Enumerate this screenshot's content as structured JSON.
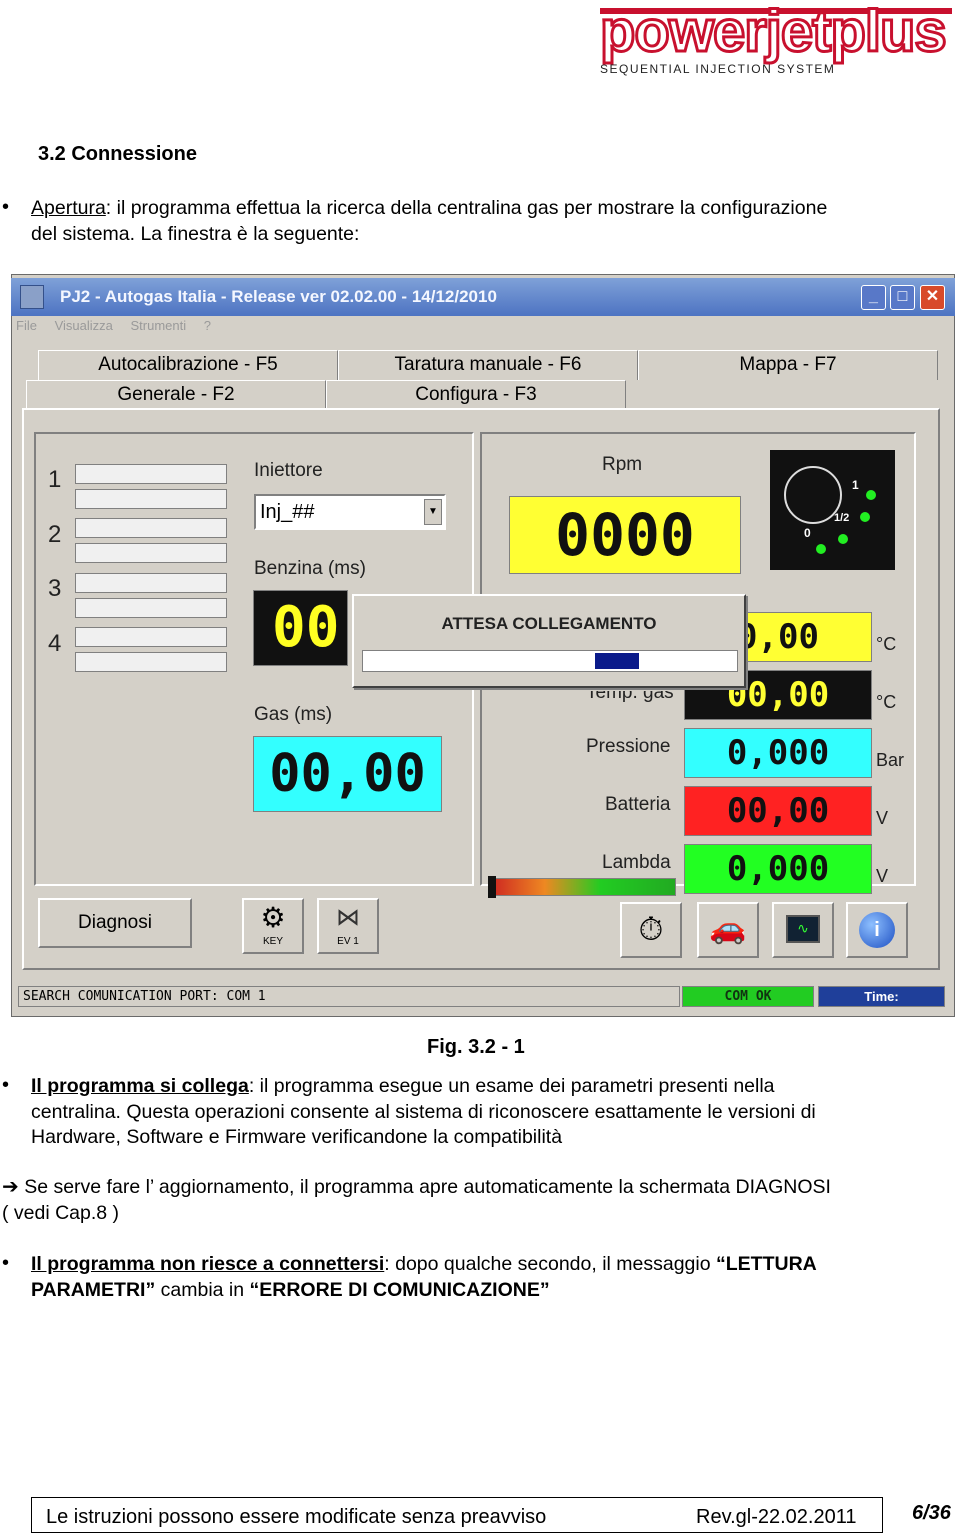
{
  "logo": {
    "name": "powerjetplus",
    "tagline": "SEQUENTIAL INJECTION SYSTEM"
  },
  "section_title": "3.2 Connessione",
  "bullet1": {
    "term": "Apertura",
    "text_line1": ": il programma effettua la ricerca della centralina gas per mostrare la configurazione",
    "text_line2": "del sistema. La finestra è la seguente:"
  },
  "app": {
    "title": "PJ2 - Autogas Italia - Release  ver 02.02.00 - 14/12/2010",
    "menu": [
      "File",
      "Visualizza",
      "Strumenti",
      "?"
    ],
    "tabs_back": [
      "Autocalibrazione - F5",
      "Taratura manuale - F6",
      "Mappa - F7"
    ],
    "tabs_front": [
      "Generale - F2",
      "Configura - F3"
    ],
    "cylinders": [
      "1",
      "2",
      "3",
      "4"
    ],
    "iniettore_label": "Iniettore",
    "iniettore_value": "Inj_##",
    "benzina_label": "Benzina (ms)",
    "benzina_value": "00,",
    "gas_label": "Gas (ms)",
    "gas_value": "00,00",
    "rpm_label": "Rpm",
    "rpm_value": "0000",
    "gauge_labels": {
      "one": "1",
      "half": "1/2",
      "zero": "0"
    },
    "temp1_value": "0,00",
    "temp1_unit": "°C",
    "temp_gas_label": "Temp. gas",
    "temp_gas_value": "00,00",
    "temp_gas_unit": "°C",
    "pressione_label": "Pressione",
    "pressione_value": "0,000",
    "pressione_unit": "Bar",
    "batteria_label": "Batteria",
    "batteria_value": "00,00",
    "batteria_unit": "V",
    "lambda_label": "Lambda",
    "lambda_value": "0,000",
    "lambda_unit": "V",
    "dialog_text": "ATTESA COLLEGAMENTO",
    "diagnosi_button": "Diagnosi",
    "key_label": "KEY",
    "ev_label": "EV 1",
    "status_text": "SEARCH COMUNICATION PORT: COM 1",
    "com_status": "COM OK",
    "time_label": "Time:"
  },
  "figure_caption": "Fig. 3.2 - 1",
  "bullet2": {
    "term": "Il programma si collega",
    "line1": ":   il programma esegue un esame dei parametri presenti nella",
    "line2": "centralina. Questa operazioni consente al sistema di riconoscere esattamente le versioni di",
    "line3": "Hardware, Software e Firmware verificandone la  compatibilità"
  },
  "arrow_note": {
    "line1": "Se serve fare l’ aggiornamento, il programma apre automaticamente la schermata  DIAGNOSI",
    "line2": "( vedi Cap.8 )"
  },
  "bullet3": {
    "term": "Il programma non riesce a connettersi",
    "text1": ": dopo qualche secondo, il messaggio ",
    "q1": "“LETTURA",
    "q1b": "PARAMETRI”",
    "text2": "  cambia in ",
    "q2": "“ERRORE DI COMUNICAZIONE”"
  },
  "footer": {
    "left": "Le istruzioni possono essere modificate senza preavviso",
    "rev": "Rev.gl-22.02.2011",
    "page": "6/36"
  },
  "colors": {
    "logo_red": "#c8102e",
    "yellow": "#ffff33",
    "cyan": "#33ffff",
    "red": "#ff2222",
    "green": "#22ff22",
    "black": "#111111",
    "progress": "#0a1a8a"
  }
}
